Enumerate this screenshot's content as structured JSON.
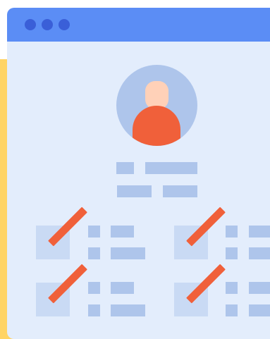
{
  "colors": {
    "accent_yellow": "#FFD465",
    "titlebar_blue": "#5B8DF5",
    "titlebar_dot": "#3A5FD8",
    "window_body": "#E3EDFC",
    "placeholder_blue": "#AEC5EB",
    "card_fill": "#C9DAF4",
    "avatar_circle": "#AEC5EB",
    "avatar_head": "#FFD1B8",
    "slash_red": "#F0603A"
  },
  "icons": {
    "profile": "person-avatar-icon",
    "strike": "strikethrough-slash-icon"
  }
}
